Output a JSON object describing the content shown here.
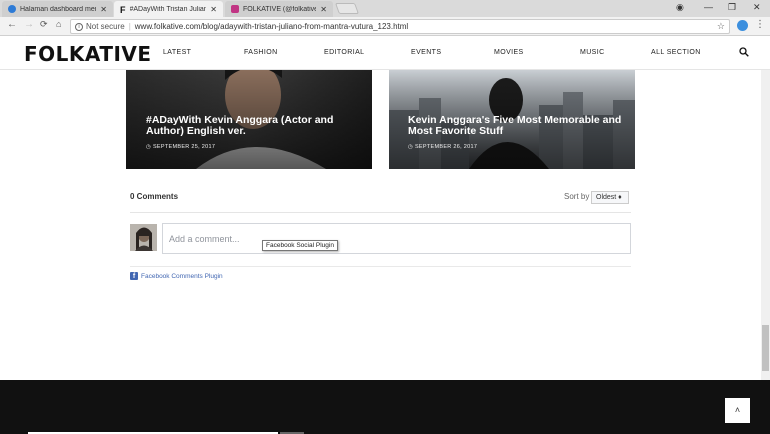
{
  "browser": {
    "tabs": [
      {
        "title": "Halaman dashboard men",
        "favicon_color": "#2e7bd6"
      },
      {
        "title": "#ADayWith Tristan Julian",
        "favicon_color": "#111111"
      },
      {
        "title": "FOLKATIVE (@folkative) ·",
        "favicon_color": "#c13584"
      }
    ],
    "security_label": "Not secure",
    "url": "www.folkative.com/blog/adaywith-tristan-juliano-from-mantra-vutura_123.html"
  },
  "site": {
    "logo": "FOLKATIVE",
    "nav": [
      "LATEST",
      "FASHION",
      "EDITORIAL",
      "EVENTS",
      "MOVIES",
      "MUSIC",
      "ALL SECTION"
    ]
  },
  "cards": [
    {
      "title": "#ADayWith Kevin Anggara (Actor and Author) English ver.",
      "date": "SEPTEMBER 25, 2017"
    },
    {
      "title": "Kevin Anggara's Five Most Memorable and Most Favorite Stuff",
      "date": "SEPTEMBER 26, 2017"
    }
  ],
  "comments": {
    "count_label": "0 Comments",
    "sort_label": "Sort by",
    "sort_value": "Oldest ♦",
    "placeholder": "Add a comment...",
    "tooltip": "Facebook Social Plugin",
    "plugin_label": "Facebook Comments Plugin"
  },
  "footer": {
    "to_top": "˄"
  },
  "colors": {
    "fb_blue": "#4267b2",
    "footer_bg": "#111111"
  }
}
